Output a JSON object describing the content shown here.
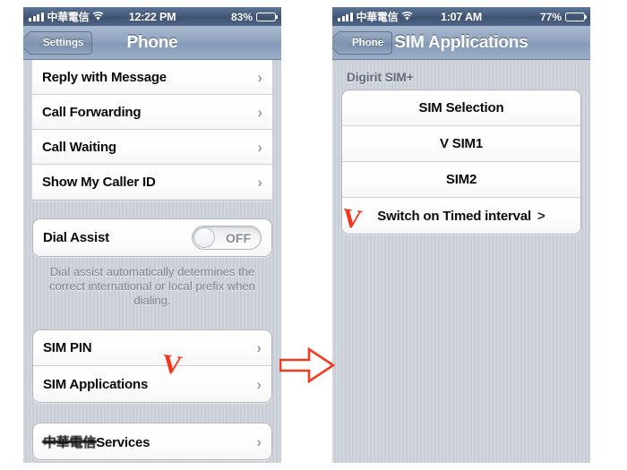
{
  "left_phone": {
    "status_bar": {
      "signal_icon": "signal-bars-icon",
      "carrier": "中華電信",
      "wifi_icon": "wifi-icon",
      "time": "12:22 PM",
      "battery_percent": "83%",
      "battery_icon": "battery-icon"
    },
    "nav": {
      "back_label": "Settings",
      "title": "Phone"
    },
    "groups": [
      {
        "rows": [
          {
            "label": "Reply with Message",
            "accessory": "chevron"
          },
          {
            "label": "Call Forwarding",
            "accessory": "chevron"
          },
          {
            "label": "Call Waiting",
            "accessory": "chevron"
          },
          {
            "label": "Show My Caller ID",
            "accessory": "chevron"
          }
        ]
      },
      {
        "rows": [
          {
            "label": "Dial Assist",
            "accessory": "toggle",
            "toggle_value": "OFF"
          }
        ],
        "footnote": "Dial assist automatically determines the correct international or local prefix when dialing."
      },
      {
        "rows": [
          {
            "label": "SIM PIN",
            "accessory": "chevron"
          },
          {
            "label": "SIM Applications",
            "accessory": "chevron",
            "annotated": true
          }
        ]
      },
      {
        "rows": [
          {
            "label_redacted": "中華電信",
            "label": "Services",
            "accessory": "chevron"
          }
        ]
      }
    ]
  },
  "right_phone": {
    "status_bar": {
      "signal_icon": "signal-bars-icon",
      "carrier": "中華電信",
      "wifi_icon": "wifi-icon",
      "time": "1:07 AM",
      "battery_percent": "77%",
      "battery_icon": "battery-icon"
    },
    "nav": {
      "back_label": "Phone",
      "title": "SIM Applications"
    },
    "group_header": "Digirit SIM+",
    "rows": [
      {
        "label": "SIM Selection",
        "accessory": "none"
      },
      {
        "label": "V  SIM1",
        "accessory": "none"
      },
      {
        "label": "SIM2",
        "accessory": "none"
      },
      {
        "label": "Switch on Timed interval",
        "accessory": "chevron-inline",
        "chevron": ">",
        "annotated": true
      }
    ]
  },
  "annotations": {
    "checkmark_glyph": "V",
    "checkmark_color": "#f4361c",
    "arrow_icon": "right-arrow-icon",
    "arrow_color": "#f23c1e"
  }
}
